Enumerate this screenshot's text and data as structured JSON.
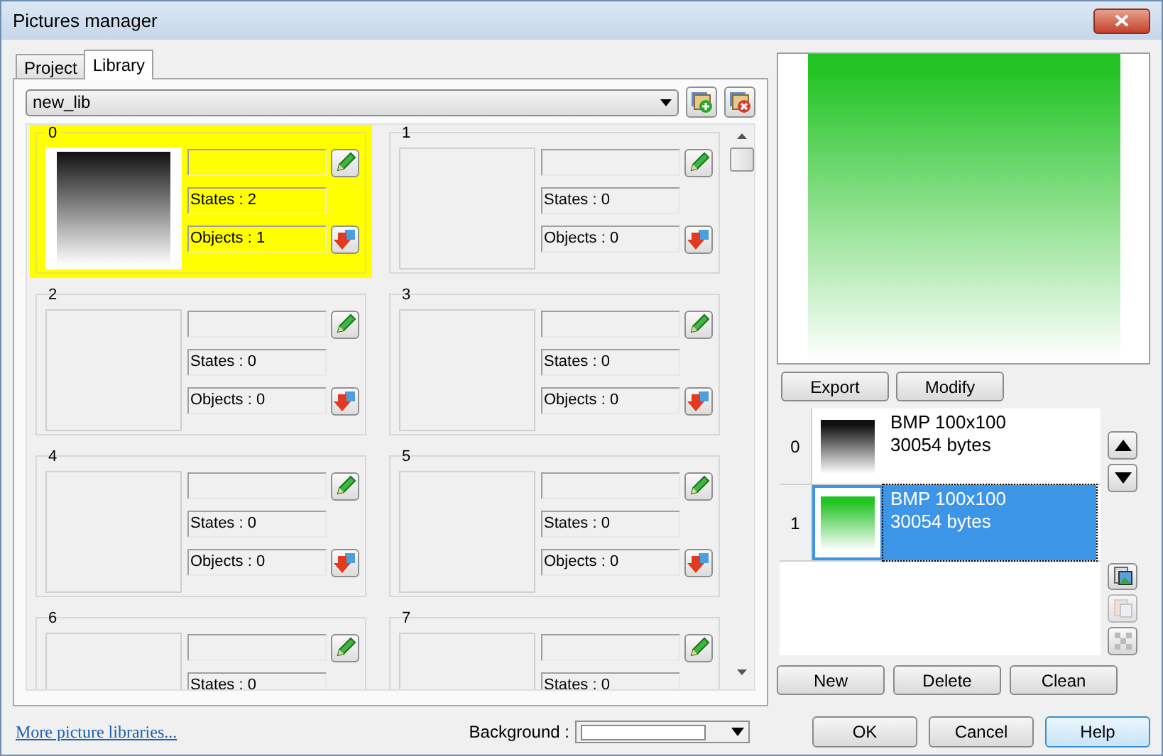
{
  "window": {
    "title": "Pictures manager"
  },
  "tabs": [
    {
      "label": "Project",
      "selected": false
    },
    {
      "label": "Library",
      "selected": true
    }
  ],
  "library": {
    "value": "new_lib"
  },
  "cells": [
    {
      "index": "0",
      "selected": true,
      "has_picture": true,
      "states": "States : 2",
      "objects": "Objects : 1"
    },
    {
      "index": "1",
      "selected": false,
      "has_picture": false,
      "states": "States : 0",
      "objects": "Objects : 0"
    },
    {
      "index": "2",
      "selected": false,
      "has_picture": false,
      "states": "States : 0",
      "objects": "Objects : 0"
    },
    {
      "index": "3",
      "selected": false,
      "has_picture": false,
      "states": "States : 0",
      "objects": "Objects : 0"
    },
    {
      "index": "4",
      "selected": false,
      "has_picture": false,
      "states": "States : 0",
      "objects": "Objects : 0"
    },
    {
      "index": "5",
      "selected": false,
      "has_picture": false,
      "states": "States : 0",
      "objects": "Objects : 0"
    },
    {
      "index": "6",
      "selected": false,
      "has_picture": false,
      "states": "States : 0"
    },
    {
      "index": "7",
      "selected": false,
      "has_picture": false,
      "states": "States : 0"
    }
  ],
  "preview_buttons": [
    "Export",
    "Modify"
  ],
  "states": [
    {
      "index": "0",
      "color": "#111111",
      "format": "BMP 100x100",
      "size": "30054 bytes",
      "selected": false
    },
    {
      "index": "1",
      "color": "#22c322",
      "format": "BMP 100x100",
      "size": "30054 bytes",
      "selected": true
    }
  ],
  "state_buttons": [
    "New",
    "Delete",
    "Clean"
  ],
  "footer": {
    "link": "More picture libraries...",
    "background_label": "Background :",
    "buttons": [
      "OK",
      "Cancel",
      "Help"
    ]
  }
}
